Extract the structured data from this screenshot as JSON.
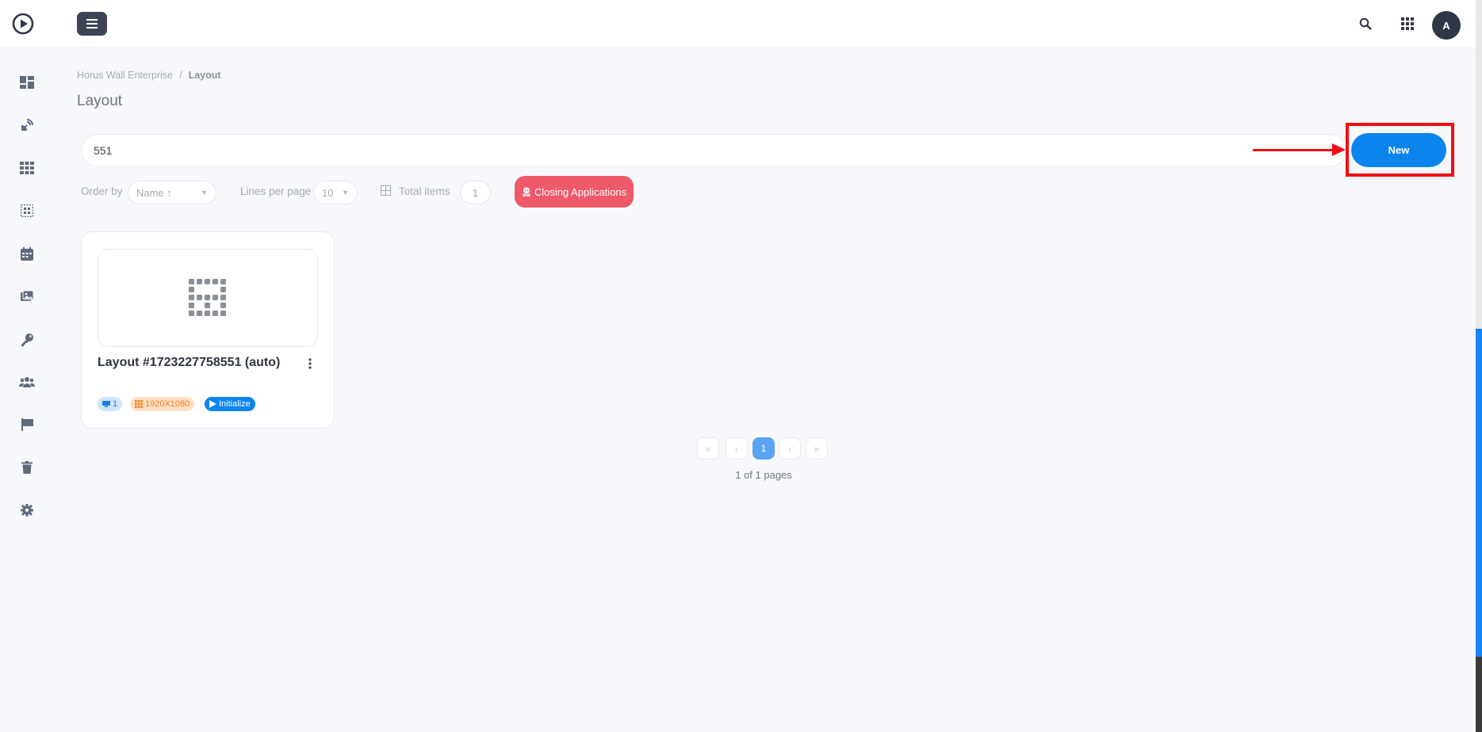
{
  "topbar": {
    "logo_icon": "play-circle-icon",
    "menu_icon": "hamburger-icon",
    "search_icon": "search-icon",
    "apps_icon": "grid-apps-icon",
    "avatar_initial": "A"
  },
  "sidebar": {
    "items": [
      {
        "name": "dashboard",
        "icon": "dashboard-icon"
      },
      {
        "name": "broadcast",
        "icon": "satellite-icon"
      },
      {
        "name": "apps",
        "icon": "grid-icon"
      },
      {
        "name": "layout",
        "icon": "layout-grid-icon"
      },
      {
        "name": "calendar",
        "icon": "calendar-icon"
      },
      {
        "name": "media",
        "icon": "images-icon"
      },
      {
        "name": "licenses",
        "icon": "key-icon"
      },
      {
        "name": "users",
        "icon": "users-icon"
      },
      {
        "name": "flags",
        "icon": "flag-icon"
      },
      {
        "name": "trash",
        "icon": "trash-icon"
      },
      {
        "name": "settings",
        "icon": "gear-icon"
      }
    ]
  },
  "breadcrumb": {
    "root": "Horus Wall Enterprise",
    "separator": "/",
    "current": "Layout"
  },
  "page_title": "Layout",
  "search": {
    "value": "551",
    "placeholder": ""
  },
  "new_button": "New",
  "filters": {
    "order_by_label": "Order by",
    "order_by_value": "Name ↑",
    "lines_label": "Lines per page",
    "lines_value": "10",
    "total_label": "Total items",
    "total_value": "1",
    "closing_label": "Closing Applications"
  },
  "cards": [
    {
      "title": "Layout #1723227758551 (auto)",
      "screens": "1",
      "resolution": "1920X1080",
      "action": "Initialize"
    }
  ],
  "pagination": {
    "first": "«",
    "prev": "‹",
    "current": "1",
    "next": "›",
    "last": "»",
    "info": "1 of 1 pages"
  },
  "colors": {
    "primary": "#0b84ee",
    "danger": "#ef5a6a",
    "highlight": "#f40d12",
    "dark": "#3d4453"
  }
}
